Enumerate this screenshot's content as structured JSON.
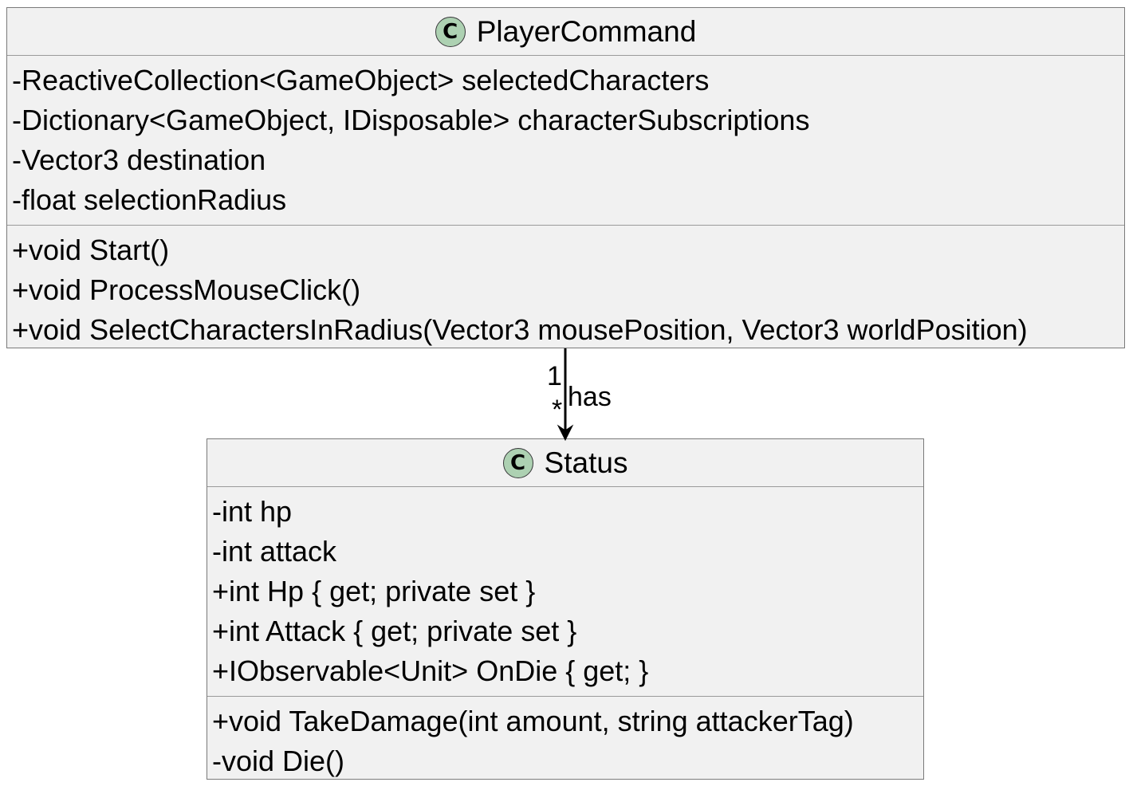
{
  "classes": {
    "player_command": {
      "name": "PlayerCommand",
      "stereotype_letter": "C",
      "attributes": [
        "-ReactiveCollection<GameObject> selectedCharacters",
        "-Dictionary<GameObject, IDisposable> characterSubscriptions",
        "-Vector3 destination",
        "-float selectionRadius"
      ],
      "methods": [
        "+void Start()",
        "+void ProcessMouseClick()",
        "+void SelectCharactersInRadius(Vector3 mousePosition, Vector3 worldPosition)"
      ]
    },
    "status": {
      "name": "Status",
      "stereotype_letter": "C",
      "attributes": [
        "-int hp",
        "-int attack",
        "+int Hp { get; private set }",
        "+int Attack { get; private set }",
        "+IObservable<Unit> OnDie { get; }"
      ],
      "methods": [
        "+void TakeDamage(int amount, string attackerTag)",
        "-void Die()"
      ]
    }
  },
  "relationship": {
    "label": "has",
    "source_multiplicity": "1",
    "target_multiplicity": "*"
  },
  "colors": {
    "class_fill": "#f1f1f1",
    "class_border": "#7a7a7a",
    "stereotype_circle": "#add1b2",
    "line": "#000000"
  }
}
